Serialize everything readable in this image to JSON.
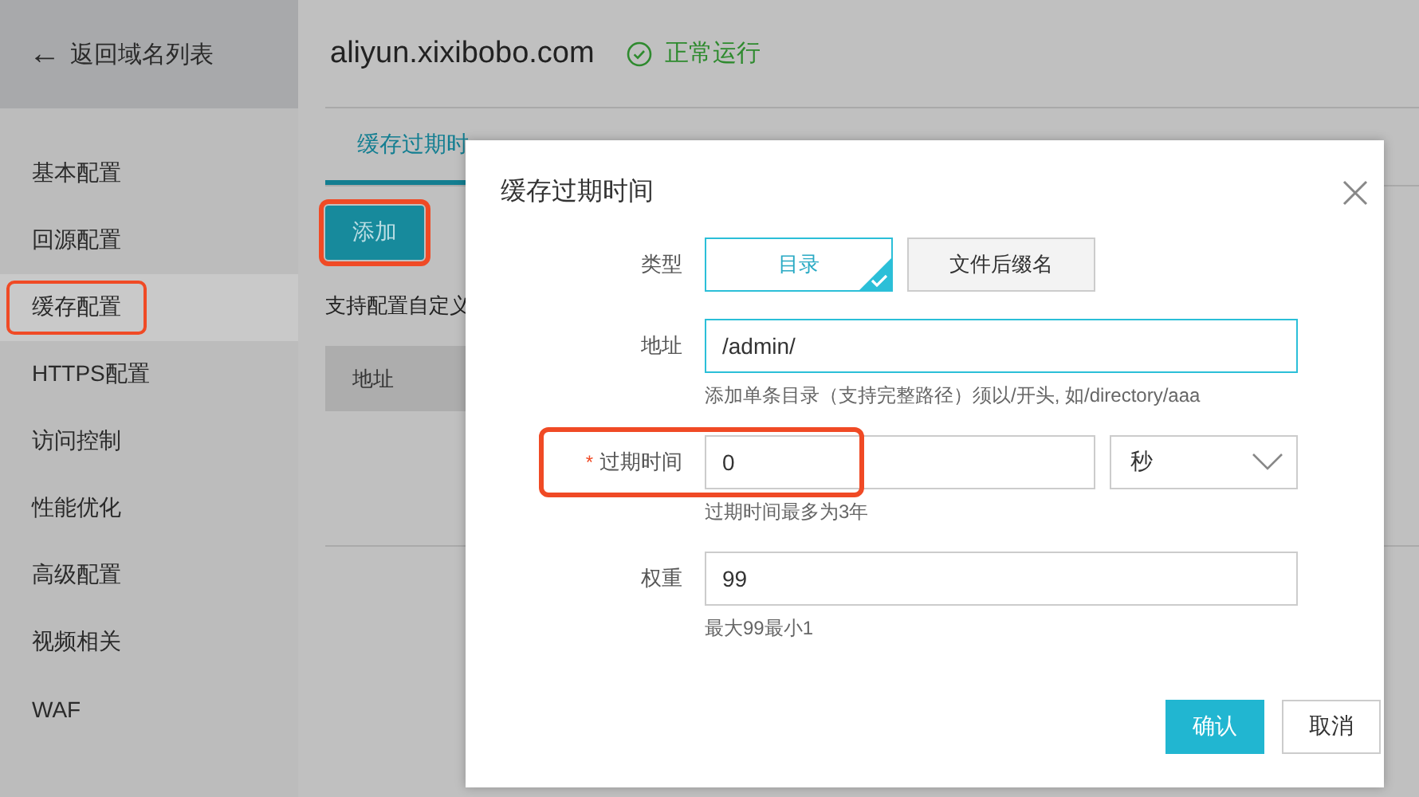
{
  "sidebar": {
    "back": {
      "icon": "←",
      "label": "返回域名列表"
    },
    "items": [
      {
        "label": "基本配置",
        "selected": false,
        "highlighted": false
      },
      {
        "label": "回源配置",
        "selected": false,
        "highlighted": false
      },
      {
        "label": "缓存配置",
        "selected": true,
        "highlighted": true
      },
      {
        "label": "HTTPS配置",
        "selected": false,
        "highlighted": false
      },
      {
        "label": "访问控制",
        "selected": false,
        "highlighted": false
      },
      {
        "label": "性能优化",
        "selected": false,
        "highlighted": false
      },
      {
        "label": "高级配置",
        "selected": false,
        "highlighted": false
      },
      {
        "label": "视频相关",
        "selected": false,
        "highlighted": false
      },
      {
        "label": "WAF",
        "selected": false,
        "highlighted": false
      }
    ]
  },
  "header": {
    "domain": "aliyun.xixibobo.com",
    "status": "正常运行"
  },
  "tabs": [
    {
      "label": "缓存过期时",
      "selected": true
    }
  ],
  "add_button": {
    "label": "添加",
    "highlighted": true
  },
  "description": "支持配置自定义",
  "table": {
    "columns": [
      "地址"
    ]
  },
  "dialog": {
    "title": "缓存过期时间",
    "type_field": {
      "label": "类型",
      "options": [
        {
          "label": "目录",
          "selected": true
        },
        {
          "label": "文件后缀名",
          "selected": false
        }
      ]
    },
    "address_field": {
      "label": "地址",
      "value": "/admin/",
      "focused": true,
      "help": "添加单条目录（支持完整路径）须以/开头, 如/directory/aaa"
    },
    "expire_field": {
      "label": "过期时间",
      "required_mark": "*",
      "highlighted": true,
      "value": "0",
      "unit": "秒",
      "help": "过期时间最多为3年"
    },
    "weight_field": {
      "label": "权重",
      "value": "99",
      "help": "最大99最小1"
    },
    "buttons": [
      {
        "label": "确认",
        "kind": "primary"
      },
      {
        "label": "取消",
        "kind": "secondary"
      }
    ]
  }
}
